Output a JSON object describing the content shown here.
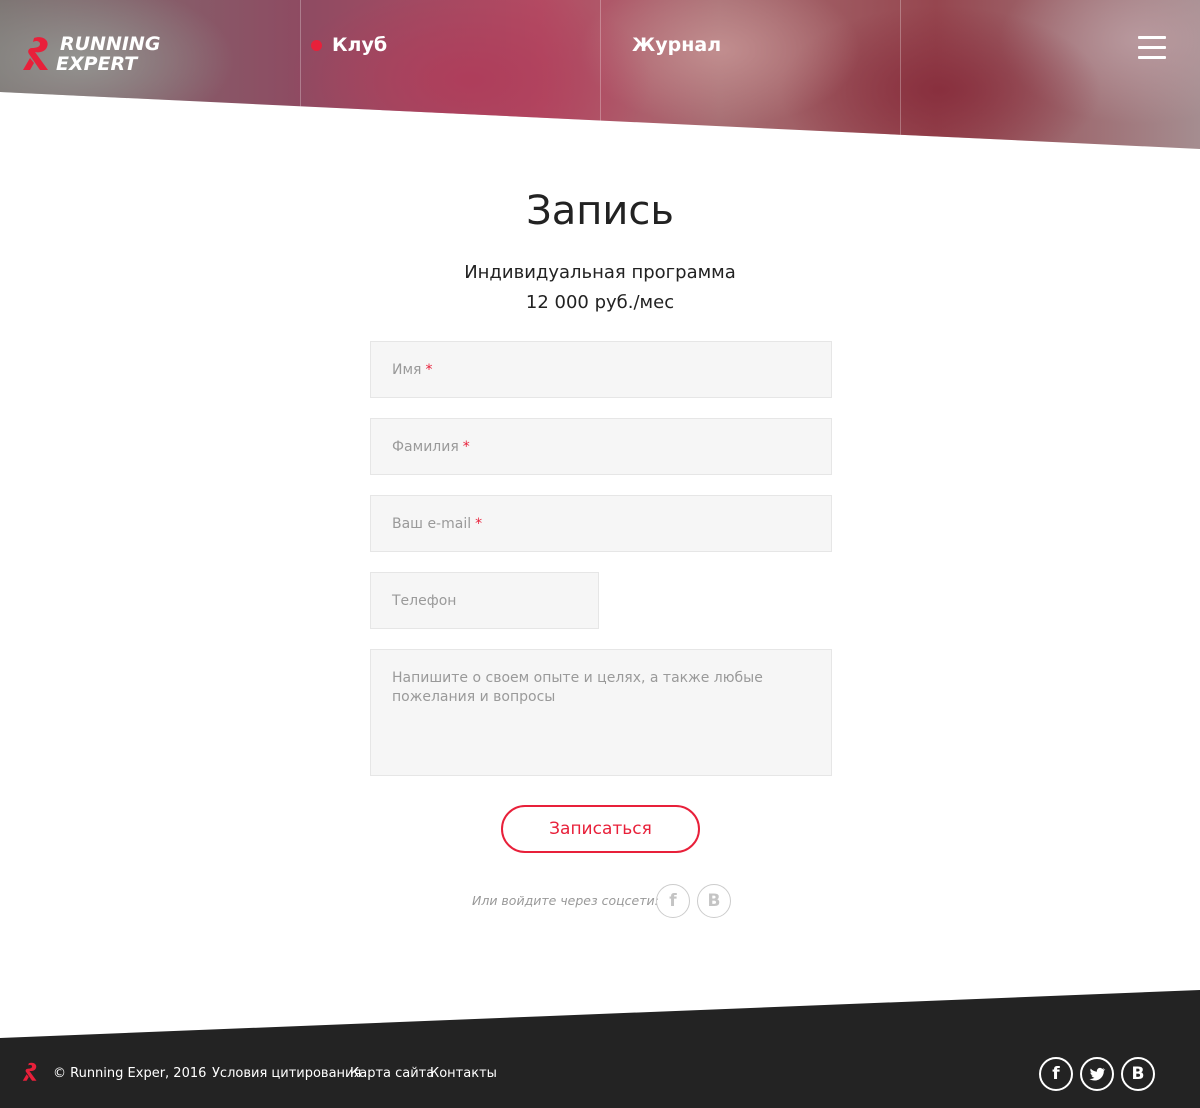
{
  "header": {
    "logo_line1": "RUNNING",
    "logo_line2": "EXPERT",
    "nav": [
      {
        "label": "Клуб",
        "active": true
      },
      {
        "label": "Журнал",
        "active": false
      }
    ]
  },
  "main": {
    "title": "Запись",
    "program": "Индивидуальная программа",
    "price": "12 000 руб./мес",
    "fields": {
      "first_name": {
        "placeholder": "Имя",
        "required_mark": "*"
      },
      "last_name": {
        "placeholder": "Фамилия",
        "required_mark": "*"
      },
      "email": {
        "placeholder": "Ваш e-mail",
        "required_mark": "*"
      },
      "phone": {
        "placeholder": "Телефон"
      },
      "message": {
        "placeholder": "Напишите о своем опыте и целях, а также любые пожелания и вопросы"
      }
    },
    "submit_label": "Записаться",
    "social_label": "Или войдите через соцсети:",
    "social": [
      {
        "icon": "facebook-icon",
        "glyph": "f"
      },
      {
        "icon": "vk-icon",
        "glyph": "В"
      }
    ]
  },
  "footer": {
    "copyright": "© Running Exper, 2016",
    "links": [
      "Условия цитирования",
      "Карта сайта",
      "Контакты"
    ],
    "social": [
      {
        "icon": "facebook-icon",
        "glyph": "f"
      },
      {
        "icon": "twitter-icon",
        "glyph": ""
      },
      {
        "icon": "vk-icon",
        "glyph": "В"
      }
    ]
  },
  "colors": {
    "accent": "#e8203a",
    "footer_bg": "#232323",
    "field_bg": "#f6f6f6"
  }
}
